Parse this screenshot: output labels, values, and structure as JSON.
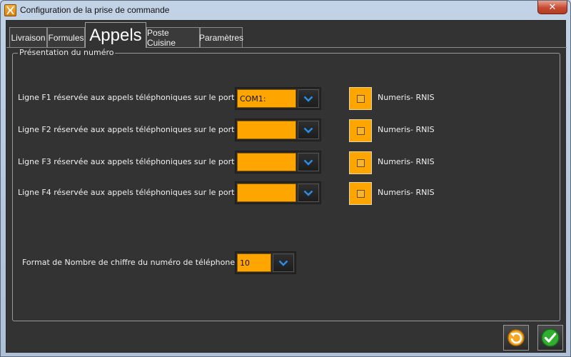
{
  "window": {
    "title": "Configuration de la prise de commande",
    "close_glyph": "✕"
  },
  "tabs": [
    {
      "label": "Livraison",
      "active": false
    },
    {
      "label": "Formules",
      "active": false
    },
    {
      "label": "Appels",
      "active": true
    },
    {
      "label": "Poste Cuisine",
      "active": false
    },
    {
      "label": "Paramètres",
      "active": false
    }
  ],
  "group": {
    "title": "Présentation du numéro"
  },
  "lines": [
    {
      "label": "Ligne F1 réservée aux appels téléphoniques sur le port :",
      "value": "COM1:",
      "check_label": "Numeris- RNIS",
      "checked": false
    },
    {
      "label": "Ligne F2 réservée aux appels téléphoniques sur le port :",
      "value": "",
      "check_label": "Numeris- RNIS",
      "checked": false
    },
    {
      "label": "Ligne F3 réservée aux appels téléphoniques sur le port :",
      "value": "",
      "check_label": "Numeris- RNIS",
      "checked": false
    },
    {
      "label": "Ligne F4 réservée aux appels téléphoniques sur le port :",
      "value": "",
      "check_label": "Numeris- RNIS",
      "checked": false
    }
  ],
  "digits": {
    "label": "Format de Nombre de chiffre du numéro de téléphone :",
    "value": "10"
  },
  "footer": {
    "cancel_icon": "undo-icon",
    "ok_icon": "check-icon"
  },
  "colors": {
    "field": "#ffa500",
    "background": "#333333",
    "accent_blue": "#2b8de8",
    "ok_green": "#2fae2f"
  }
}
